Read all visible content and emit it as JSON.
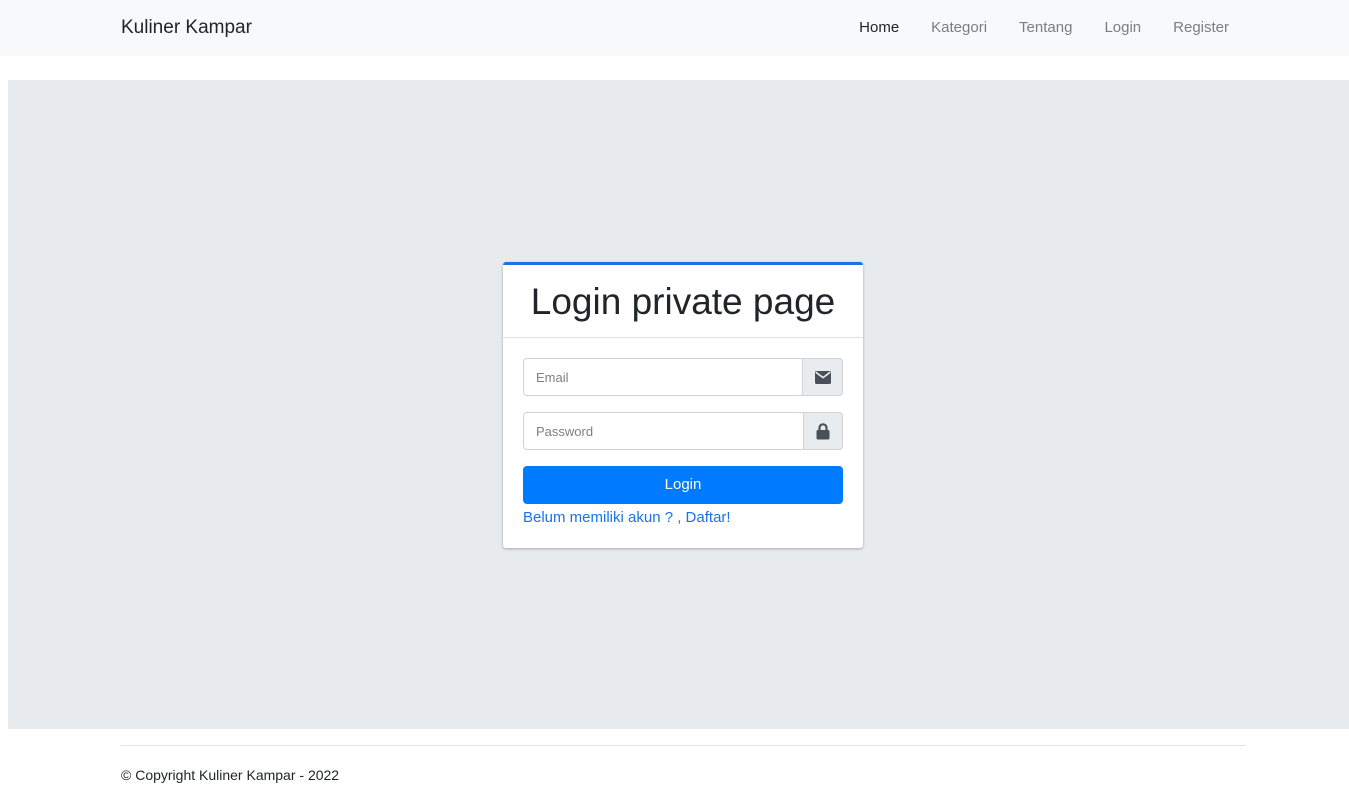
{
  "navbar": {
    "brand": "Kuliner Kampar",
    "links": [
      {
        "label": "Home",
        "active": true
      },
      {
        "label": "Kategori",
        "active": false
      },
      {
        "label": "Tentang",
        "active": false
      },
      {
        "label": "Login",
        "active": false
      },
      {
        "label": "Register",
        "active": false
      }
    ]
  },
  "login_card": {
    "title": "Login private page",
    "email": {
      "value": "",
      "placeholder": "Email",
      "icon": "envelope-icon"
    },
    "password": {
      "value": "",
      "placeholder": "Password",
      "icon": "lock-icon"
    },
    "submit_label": "Login",
    "register_link": "Belum memiliki akun ? , Daftar!"
  },
  "footer": {
    "copyright": "© Copyright Kuliner Kampar - 2022"
  },
  "colors": {
    "primary": "#007bff",
    "link": "#1a73e8",
    "card_accent": "#1a73e8",
    "navbar_bg": "#f8f9fa",
    "jumbotron_bg": "#e8ebee"
  }
}
